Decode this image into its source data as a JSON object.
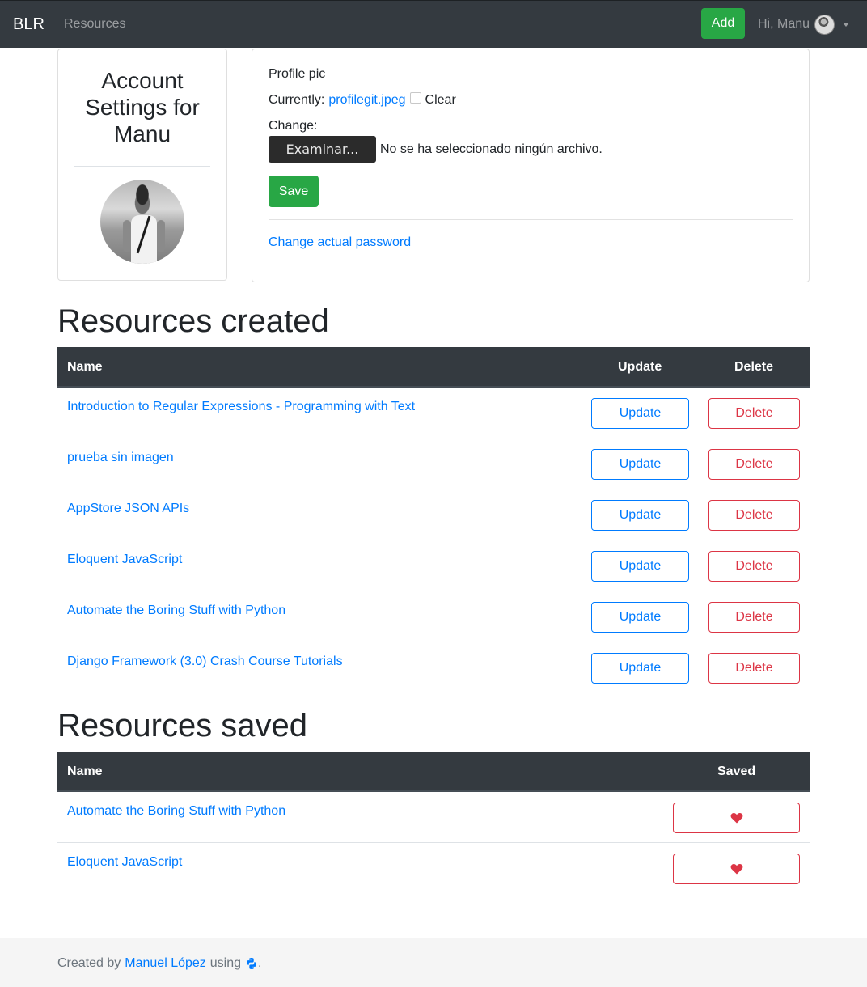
{
  "navbar": {
    "brand": "BLR",
    "resources_link": "Resources",
    "add_button": "Add",
    "user_greeting": "Hi, Manu"
  },
  "account": {
    "title": "Account Settings for Manu"
  },
  "profile_form": {
    "profile_pic_label": "Profile pic",
    "currently_label": "Currently:",
    "current_file": "profilegit.jpeg",
    "clear_label": "Clear",
    "change_label": "Change:",
    "browse_button": "Examinar...",
    "file_status": "No se ha seleccionado ningún archivo.",
    "save_button": "Save",
    "change_password_link": "Change actual password"
  },
  "resources_created": {
    "title": "Resources created",
    "columns": [
      "Name",
      "Update",
      "Delete"
    ],
    "update_label": "Update",
    "delete_label": "Delete",
    "rows": [
      {
        "name": "Introduction to Regular Expressions - Programming with Text"
      },
      {
        "name": "prueba sin imagen"
      },
      {
        "name": "AppStore JSON APIs"
      },
      {
        "name": "Eloquent JavaScript"
      },
      {
        "name": "Automate the Boring Stuff with Python"
      },
      {
        "name": "Django Framework (3.0) Crash Course Tutorials"
      }
    ]
  },
  "resources_saved": {
    "title": "Resources saved",
    "columns": [
      "Name",
      "Saved"
    ],
    "rows": [
      {
        "name": "Automate the Boring Stuff with Python"
      },
      {
        "name": "Eloquent JavaScript"
      }
    ]
  },
  "footer": {
    "created_by": "Created by",
    "author": "Manuel López",
    "using": "using",
    "period": "."
  },
  "colors": {
    "navbar_bg": "#343a40",
    "success": "#28a745",
    "primary": "#007bff",
    "danger": "#dc3545",
    "footer_bg": "#f5f5f5"
  },
  "icons": {
    "avatar": "user-avatar",
    "heart": "heart-icon",
    "python": "python-icon"
  }
}
